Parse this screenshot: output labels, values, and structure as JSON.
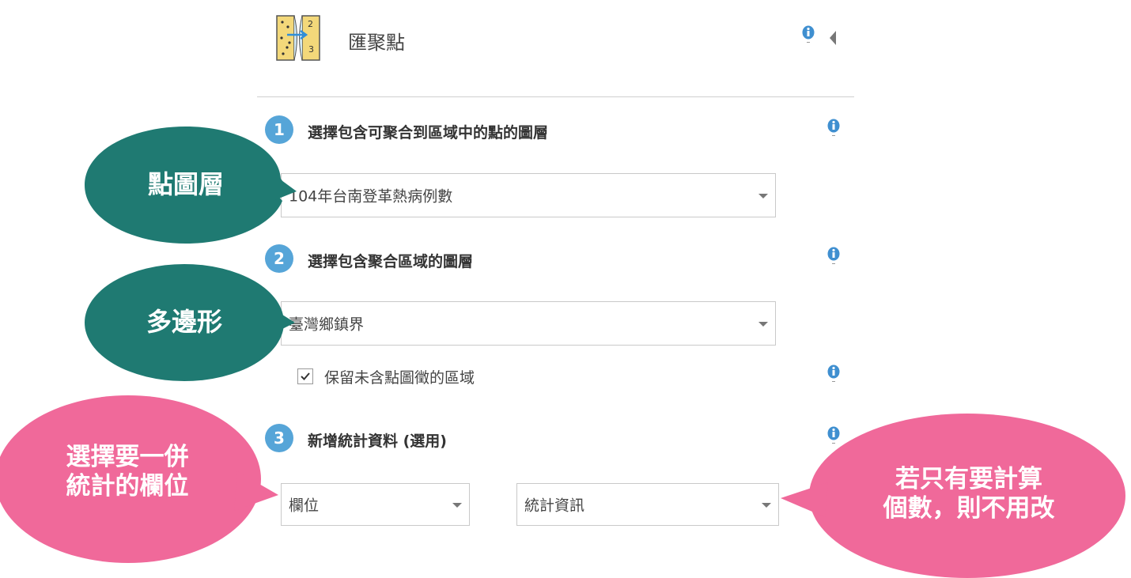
{
  "header": {
    "title": "匯聚點",
    "icon": "aggregate-points-tool-icon",
    "icon_digits": [
      "2",
      "3"
    ]
  },
  "steps": [
    {
      "number": "1",
      "label": "選擇包含可聚合到區域中的點的圖層",
      "select_value": "104年台南登革熱病例數"
    },
    {
      "number": "2",
      "label": "選擇包含聚合區域的圖層",
      "select_value": "臺灣鄉鎮界",
      "checkbox_label": "保留未含點圖徵的區域",
      "checkbox_checked": true
    },
    {
      "number": "3",
      "label": "新增統計資料 (選用)",
      "field_select_value": "欄位",
      "statistic_select_value": "統計資訊"
    }
  ],
  "callouts": {
    "point_layer": "點圖層",
    "polygon": "多邊形",
    "choose_field_line1": "選擇要一併",
    "choose_field_line2": "統計的欄位",
    "count_only_line1": "若只有要計算",
    "count_only_line2": "個數，則不用改"
  },
  "colors": {
    "step_circle": "#56a5d8",
    "info_icon": "#3f8fd0",
    "teal_callout": "#1f7a72",
    "pink_callout": "#f0699a",
    "divider": "#cfcfcf"
  }
}
